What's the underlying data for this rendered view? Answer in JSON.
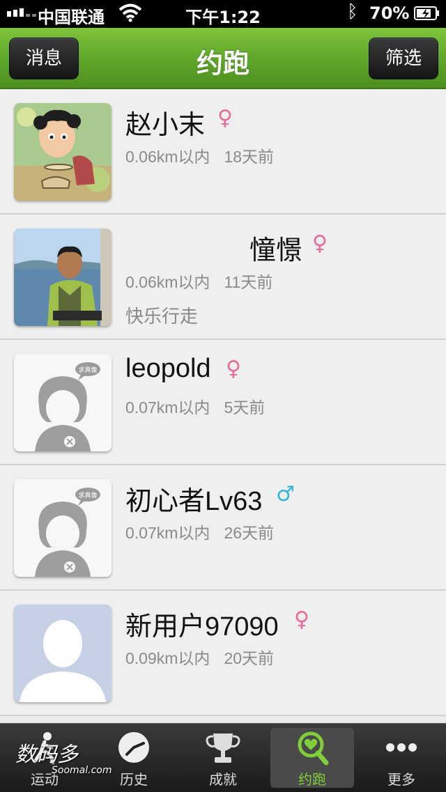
{
  "status_bar": {
    "carrier": "中国联通",
    "time": "下午1:22",
    "battery": "70%"
  },
  "nav": {
    "title": "约跑",
    "left_button": "消息",
    "right_button": "筛选"
  },
  "users": [
    {
      "name": "赵小末",
      "gender": "♀",
      "distance": "0.06km以内",
      "ago": "18天前",
      "motto": ""
    },
    {
      "name": "憧憬",
      "gender": "♀",
      "distance": "0.06km以内",
      "ago": "11天前",
      "motto": "快乐行走"
    },
    {
      "name": "leopold",
      "gender": "♀",
      "distance": "0.07km以内",
      "ago": "5天前",
      "motto": ""
    },
    {
      "name": "初心者Lv63",
      "gender": "♂",
      "distance": "0.07km以内",
      "ago": "26天前",
      "motto": ""
    },
    {
      "name": "新用户97090",
      "gender": "♀",
      "distance": "0.09km以内",
      "ago": "20天前",
      "motto": ""
    }
  ],
  "colors": {
    "female": "#e9699f",
    "male": "#2fb6d6",
    "accent": "#6bb331"
  },
  "placeholder_bubble": "求真像",
  "tabs": [
    {
      "label": "运动",
      "icon": "runner-icon"
    },
    {
      "label": "历史",
      "icon": "history-icon"
    },
    {
      "label": "成就",
      "icon": "trophy-icon"
    },
    {
      "label": "约跑",
      "icon": "search-heart-icon",
      "active": true
    },
    {
      "label": "更多",
      "icon": "more-icon"
    }
  ],
  "watermark": {
    "text": "数码多",
    "sub": "Soomal.com"
  }
}
